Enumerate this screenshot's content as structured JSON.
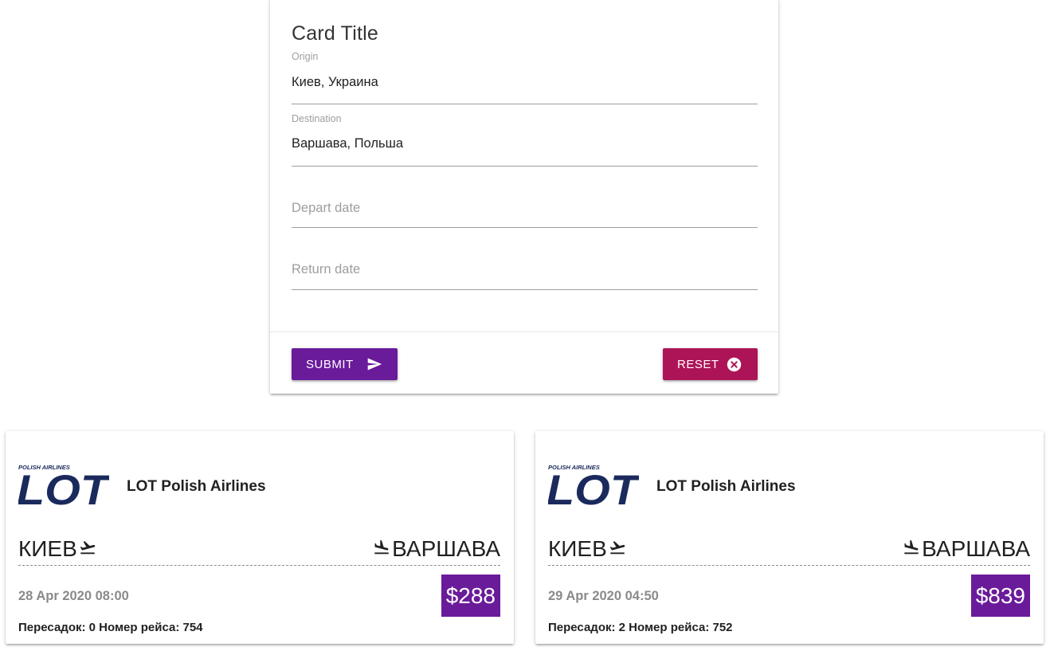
{
  "search_form": {
    "title": "Card Title",
    "origin": {
      "label": "Origin",
      "value": "Киев, Украина"
    },
    "destination": {
      "label": "Destination",
      "value": "Варшава, Польша"
    },
    "depart_date": {
      "placeholder": "Depart date"
    },
    "return_date": {
      "placeholder": "Return date"
    },
    "submit_label": "SUBMIT",
    "submit_icon": "send-icon",
    "reset_label": "RESET",
    "reset_icon": "cancel-circle-icon"
  },
  "tickets": [
    {
      "logo_text": "POLISH AIRLINES",
      "logo_mark": "LOT",
      "airline": "LOT Polish Airlines",
      "from": "КИЕВ",
      "to": "ВАРШАВА",
      "date": "28 Apr 2020 08:00",
      "price": "$288",
      "details": "Пересадок: 0 Номер рейса: 754"
    },
    {
      "logo_text": "POLISH AIRLINES",
      "logo_mark": "LOT",
      "airline": "LOT Polish Airlines",
      "from": "КИЕВ",
      "to": "ВАРШАВА",
      "date": "29 Apr 2020 04:50",
      "price": "$839",
      "details": "Пересадок: 2 Номер рейса: 752"
    }
  ],
  "colors": {
    "primary": "#6a1b9a",
    "secondary": "#ad1457",
    "logo_navy": "#1b2a5c"
  }
}
